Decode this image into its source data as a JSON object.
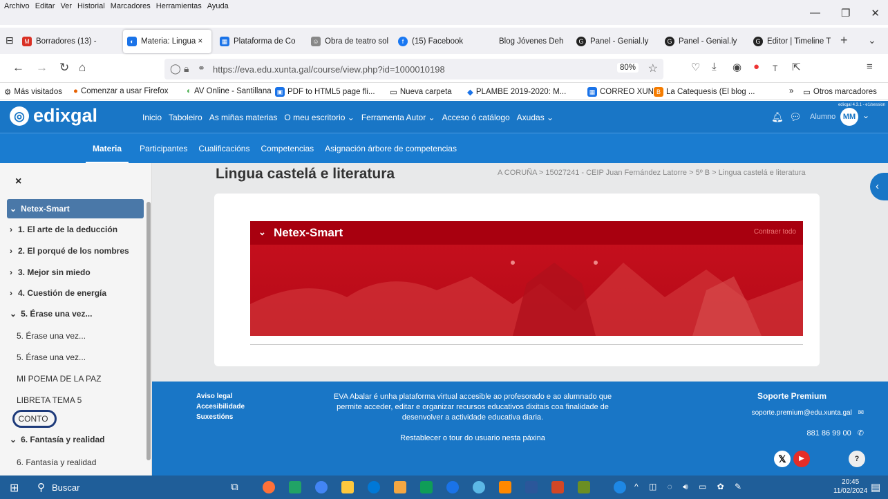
{
  "browser": {
    "menu": [
      "Archivo",
      "Editar",
      "Ver",
      "Historial",
      "Marcadores",
      "Herramientas",
      "Ayuda"
    ],
    "tabs": [
      {
        "label": "Borradores (13) -",
        "icon": "gmail-icon",
        "color": "#d93025"
      },
      {
        "label": "Materia: Lingua ×",
        "icon": "eva-icon",
        "color": "#1a73e8"
      },
      {
        "label": "Plataforma de Co",
        "icon": "platform-icon",
        "color": "#1a73e8"
      },
      {
        "label": "Obra de teatro sol",
        "icon": "theater-icon",
        "color": "#888888"
      },
      {
        "label": "(15) Facebook",
        "icon": "facebook-icon",
        "color": "#1877f2"
      },
      {
        "label": "Blog Jóvenes Deh",
        "icon": "blog-icon",
        "color": "#cccccc"
      },
      {
        "label": "Panel - Genial.ly",
        "icon": "genially-icon",
        "color": "#222222"
      },
      {
        "label": "Panel - Genial.ly",
        "icon": "genially-icon",
        "color": "#222222"
      },
      {
        "label": "Editor | Timeline T",
        "icon": "genially-icon",
        "color": "#222222"
      }
    ],
    "url": "https://eva.edu.xunta.gal/course/view.php?id=1000010198",
    "zoom": "80%",
    "bookmarks": [
      "Más visitados",
      "Comenzar a usar Firefox",
      "AV Online - Santillana",
      "PDF to HTML5 page fli...",
      "Nueva carpeta",
      "PLAMBE 2019-2020: M...",
      "CORREO XUNTA",
      "La Catequesis (El blog ..."
    ],
    "other_bookmarks": "Otros marcadores"
  },
  "site": {
    "logo": "edixgal",
    "nav": [
      "Inicio",
      "Taboleiro",
      "As miñas materias",
      "O meu escritorio ⌄",
      "Ferramenta Autor ⌄",
      "Acceso ó catálogo",
      "Axudas ⌄"
    ],
    "version": "edixgal 4.3.1 - e1/session",
    "user_label": "Alumno",
    "avatar": "MM",
    "subnav": [
      "Materia",
      "Participantes",
      "Cualificacións",
      "Competencias",
      "Asignación árbore de competencias"
    ]
  },
  "sidebar": {
    "close": "×",
    "items": [
      {
        "label": "Netex-Smart",
        "chev": "⌄"
      },
      {
        "label": "1. El arte de la deducción",
        "chev": "›"
      },
      {
        "label": "2. El porqué de los nombres",
        "chev": "›"
      },
      {
        "label": "3. Mejor sin miedo",
        "chev": "›"
      },
      {
        "label": "4. Cuestión de energía",
        "chev": "›"
      },
      {
        "label": "5. Érase una vez...",
        "chev": "⌄"
      },
      {
        "label": "5. Érase una vez..."
      },
      {
        "label": "5. Érase una vez..."
      },
      {
        "label": "MI POEMA DE LA PAZ"
      },
      {
        "label": "LIBRETA TEMA 5"
      },
      {
        "label": "CONTO"
      },
      {
        "label": "6. Fantasía y realidad",
        "chev": "⌄"
      },
      {
        "label": "6. Fantasía y realidad"
      }
    ]
  },
  "page": {
    "title": "Lingua castelá e literatura",
    "breadcrumb": "A CORUÑA  >  15027241 - CEIP Juan Fernández Latorre  >  5º B  >  Lingua castelá e literatura",
    "section_title": "Netex-Smart",
    "collapse_all": "Contraer todo"
  },
  "footer": {
    "links": [
      "Aviso legal",
      "Accesibilidade",
      "Suxestións"
    ],
    "description": "EVA Abalar é unha plataforma virtual accesible ao profesorado e ao alumnado que permite acceder, editar e organizar recursos educativos dixitais coa finalidade de desenvolver a actividade educativa diaria.",
    "tour": "Restablecer o tour do usuario nesta páxina",
    "support_title": "Soporte Premium",
    "email": "soporte.premium@edu.xunta.gal",
    "phone": "881 86 99 00"
  },
  "taskbar": {
    "search": "Buscar",
    "time": "20:45",
    "date": "11/02/2024"
  }
}
